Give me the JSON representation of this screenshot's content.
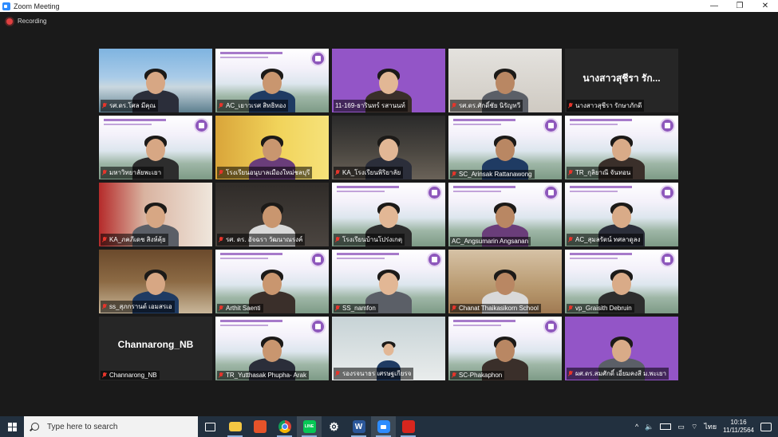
{
  "window": {
    "title": "Zoom Meeting",
    "controls": [
      "—",
      "❐",
      "✕"
    ]
  },
  "recording": {
    "label": "Recording"
  },
  "participants": [
    {
      "name": "รศ.ดร.โศล มีคุณ",
      "muted": true,
      "bg": "photo-sea"
    },
    {
      "name": "AC_เยาวเรศ สิทธิทอง",
      "muted": true,
      "bg": "slide"
    },
    {
      "name": "11-169-ธารินทร์ รสานนท์",
      "muted": false,
      "bg": "purple"
    },
    {
      "name": "รศ.ดร.ศักดิ์ชัย นิรัญทวี",
      "muted": true,
      "bg": "photo-office"
    },
    {
      "name": "นางสาวสุชีรา รักษาภักดี",
      "display_name": "นางสาวสุชีรา รัก...",
      "muted": true,
      "bg": "dark"
    },
    {
      "name": "มหาวิทยาลัยพะเยา",
      "muted": true,
      "bg": "slide"
    },
    {
      "name": "โรงเรียนอนุบาลเมืองใหม่ชลบุรี",
      "muted": true,
      "bg": "photo-yellow"
    },
    {
      "name": "KA_โรงเรียนพิริยาลัย",
      "muted": true,
      "bg": "photo-room"
    },
    {
      "name": "SC_Arinsak Rattanawong",
      "muted": true,
      "bg": "slide"
    },
    {
      "name": "TR_กุลิยาณี จันทอน",
      "muted": true,
      "bg": "slide"
    },
    {
      "name": "KA_ภคภีเดช สิงห์คุ้ย",
      "muted": true,
      "bg": "photo-red"
    },
    {
      "name": "รศ. ดร. อัจฉรา วัฒนาณรงค์",
      "muted": true,
      "bg": "photo-dark"
    },
    {
      "name": "โรงเรียนบ้านโปร่งเกตุ",
      "muted": true,
      "bg": "slide"
    },
    {
      "name": "AC_Angsumarin Angsanan",
      "muted": false,
      "bg": "slide",
      "active": true
    },
    {
      "name": "AC_สุมลรัตน์ ทศลาดูลง",
      "muted": true,
      "bg": "slide"
    },
    {
      "name": "ss_สุภกรานต์ เอมสรเอ",
      "muted": true,
      "bg": "photo-books"
    },
    {
      "name": "Arthit Saenti",
      "muted": true,
      "bg": "slide"
    },
    {
      "name": "SS_namfon",
      "muted": true,
      "bg": "slide"
    },
    {
      "name": "Chanat Thaikasikorn School",
      "muted": true,
      "bg": "photo-home"
    },
    {
      "name": "vp_Graisith Debruin",
      "muted": true,
      "bg": "slide"
    },
    {
      "name": "Channarong_NB",
      "display_name": "Channarong_NB",
      "muted": true,
      "bg": "dark"
    },
    {
      "name": "TR_Yutthasak Phupha- Arak",
      "muted": true,
      "bg": "slide"
    },
    {
      "name": "รองรจนาธร เศรษฐเกียรจ",
      "muted": true,
      "bg": "photo-white"
    },
    {
      "name": "SC-Phakaphon",
      "muted": true,
      "bg": "slide"
    },
    {
      "name": "ผศ.ดร.สมศักดิ์ เอี่ยมคงสี ม.พะเยา",
      "muted": true,
      "bg": "purple"
    }
  ],
  "taskbar": {
    "search_placeholder": "Type here to search",
    "apps": [
      {
        "name": "task-view",
        "label": ""
      },
      {
        "name": "file-explorer",
        "label": ""
      },
      {
        "name": "office",
        "label": ""
      },
      {
        "name": "chrome",
        "label": ""
      },
      {
        "name": "line",
        "label": "LINE"
      },
      {
        "name": "settings",
        "label": ""
      },
      {
        "name": "word",
        "label": "W"
      },
      {
        "name": "zoom",
        "label": ""
      },
      {
        "name": "acrobat",
        "label": ""
      }
    ],
    "tray": {
      "language": "ไทย",
      "time": "10:16",
      "date": "11/11/2564"
    }
  },
  "colors": {
    "accent": "#2d8cff",
    "active_speaker": "#9ccc3c",
    "mute": "#e5352b",
    "taskbar": "#22303f"
  }
}
